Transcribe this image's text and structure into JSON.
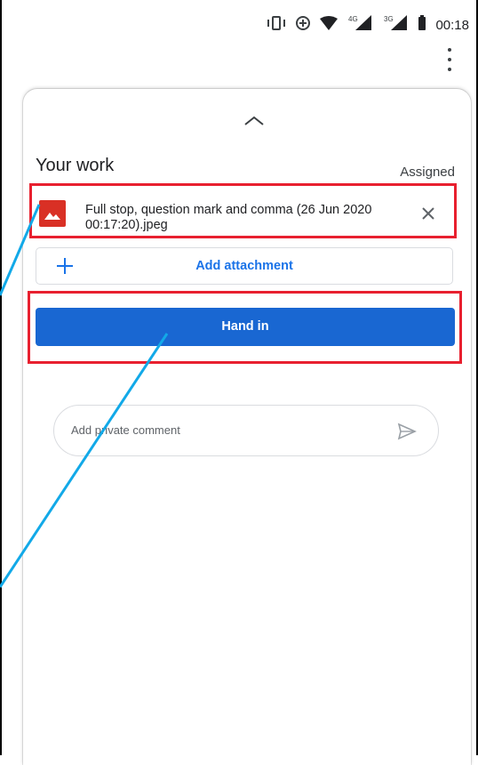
{
  "status_bar": {
    "time": "00:18",
    "network_4g": "4G",
    "network_3g": "3G",
    "icons": [
      "vibrate-icon",
      "data-saver-icon",
      "wifi-icon",
      "signal-4g-icon",
      "signal-3g-icon",
      "battery-icon"
    ]
  },
  "toolbar": {
    "menu_icon": "more-vert-icon"
  },
  "sheet": {
    "handle_icon": "chevron-up-icon",
    "title": "Your work",
    "status": "Assigned",
    "attachment": {
      "name": "Full stop, question mark and comma (26 Jun 2020 00:17:20).jpeg",
      "thumb_icon": "image-icon",
      "remove_icon": "close-icon"
    },
    "add_attachment_label": "Add attachment",
    "hand_in_label": "Hand in",
    "comment_placeholder": "Add private comment",
    "send_icon": "send-icon"
  },
  "colors": {
    "primary": "#1967d2",
    "link": "#1a73e8",
    "highlight": "#e8202f",
    "annotation_line": "#12a9e8",
    "thumb": "#d93025"
  }
}
